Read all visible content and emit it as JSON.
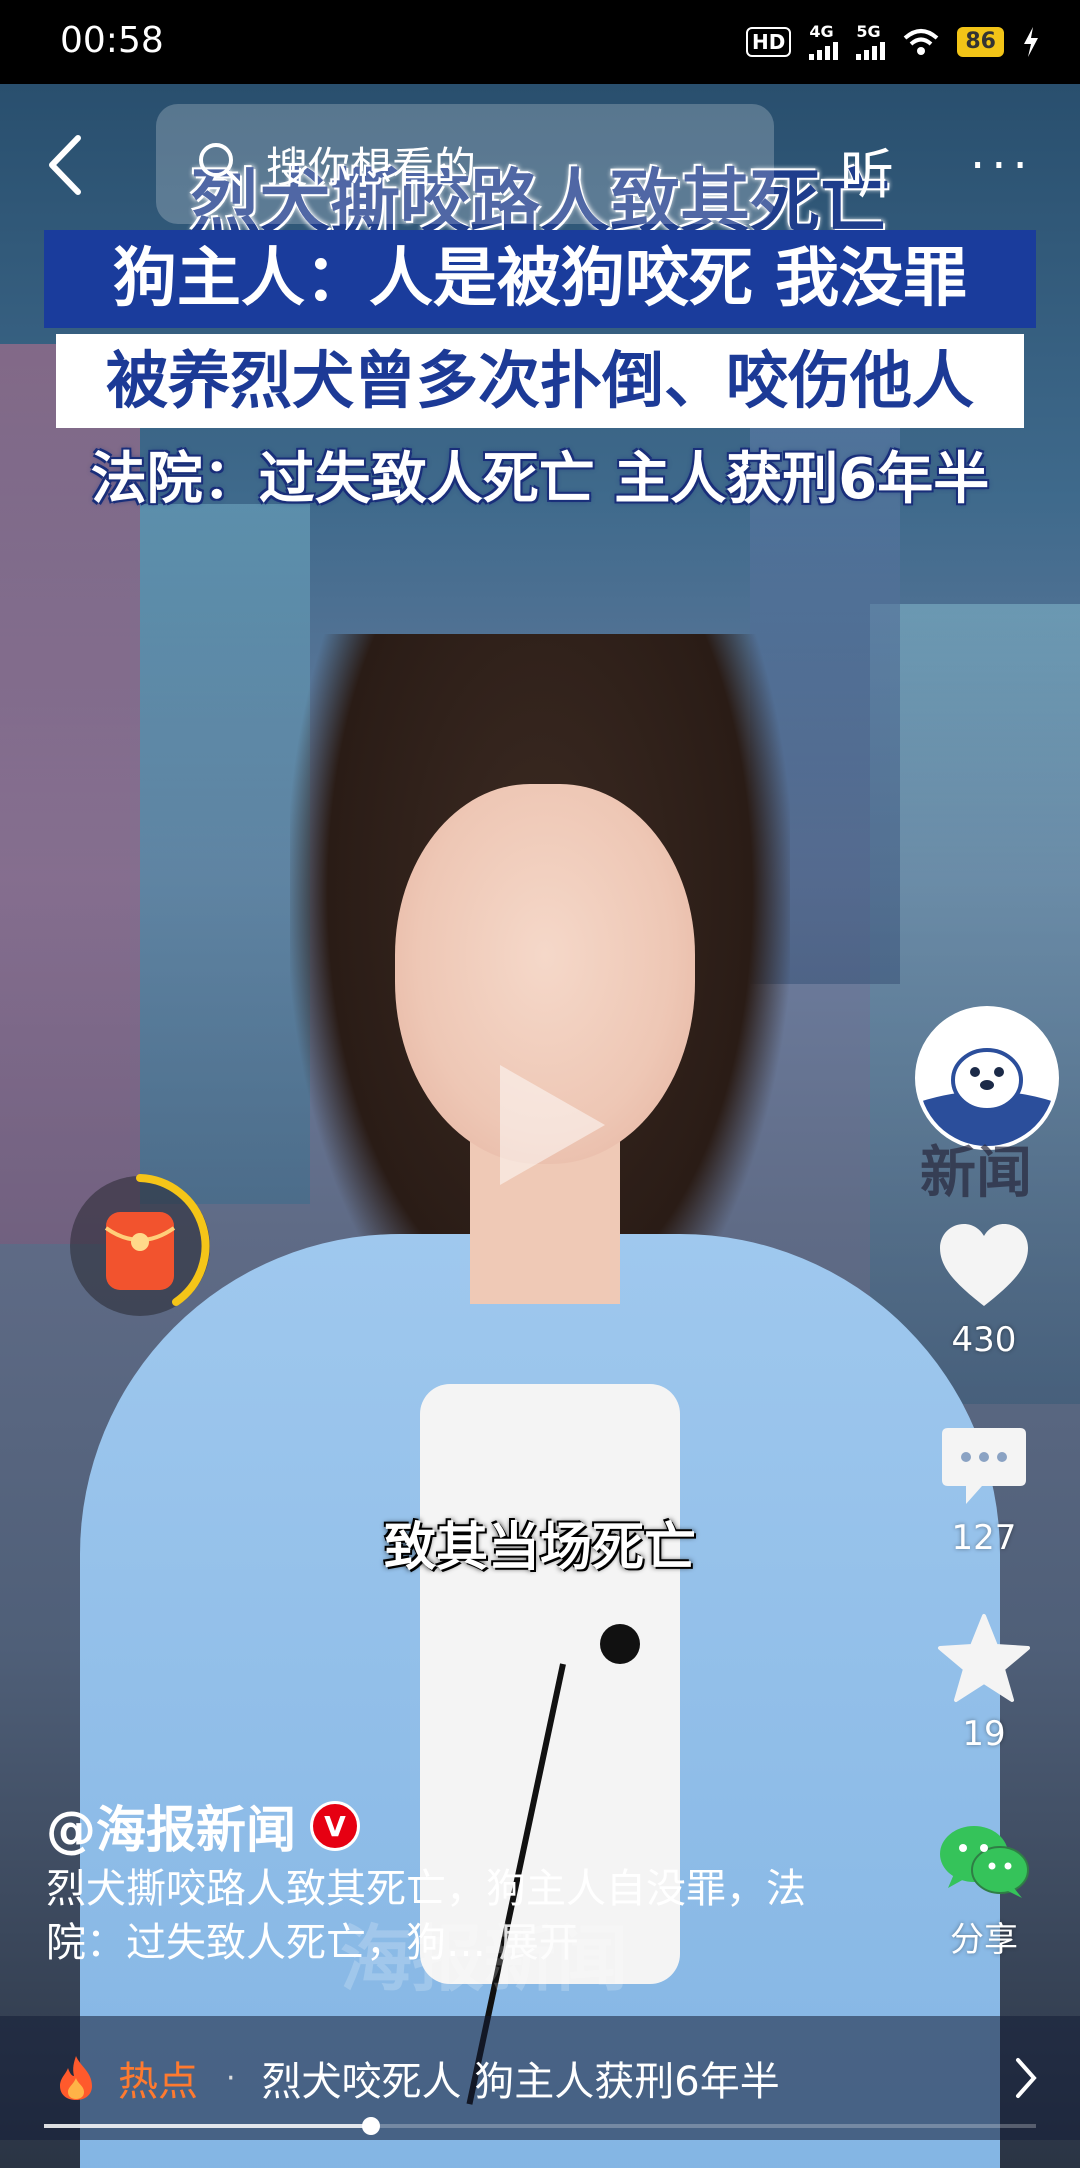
{
  "status": {
    "time": "00:58",
    "hd": "HD",
    "network1": "4G",
    "network2": "5G",
    "battery": "86"
  },
  "header": {
    "search_placeholder": "搜你想看的",
    "listen": "听",
    "more": "···"
  },
  "headlines": {
    "line1": "烈犬撕咬路人致其死亡",
    "line2": "狗主人：人是被狗咬死 我没罪",
    "line3": "被养烈犬曾多次扑倒、咬伤他人",
    "line4": "法院：过失致人死亡 主人获刑6年半"
  },
  "video": {
    "subtitle": "致其当场死亡",
    "watermark": "海报新闻",
    "progress_percent": 33
  },
  "rail": {
    "avatar_text": "新闻",
    "likes": "430",
    "comments": "127",
    "favorites": "19",
    "share": "分享"
  },
  "post": {
    "author": "@海报新闻",
    "verified": "V",
    "description": "烈犬撕咬路人致其死亡，狗主人自没罪，法院：过失致人死亡，狗…",
    "expand": "展开"
  },
  "hot": {
    "label": "热点",
    "dot": "·",
    "text": "烈犬咬死人 狗主人获刑6年半"
  },
  "colors": {
    "accent_orange": "#ff7a2f",
    "headline_blue": "#1a3c9c",
    "verified_red": "#e60012",
    "battery_yellow": "#f2c417",
    "wechat_green": "#35c35a"
  }
}
